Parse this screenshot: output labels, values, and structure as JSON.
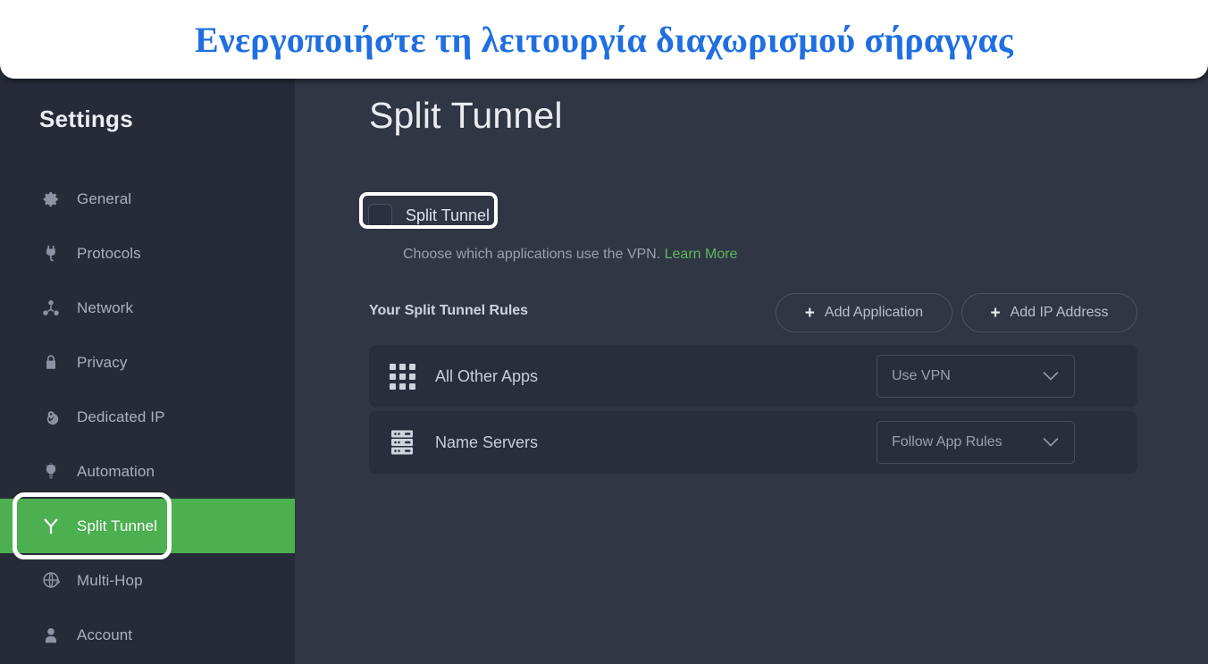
{
  "banner": {
    "text": "Ενεργοποιήστε τη λειτουργία διαχωρισμού σήραγγας",
    "color": "#1f6fe0"
  },
  "sidebar": {
    "title": "Settings",
    "active_index": 6,
    "items": [
      {
        "label": "General",
        "icon": "gear-icon"
      },
      {
        "label": "Protocols",
        "icon": "plug-icon"
      },
      {
        "label": "Network",
        "icon": "network-nodes-icon"
      },
      {
        "label": "Privacy",
        "icon": "lock-icon"
      },
      {
        "label": "Dedicated IP",
        "icon": "globe-pin-icon"
      },
      {
        "label": "Automation",
        "icon": "lightbulb-icon"
      },
      {
        "label": "Split Tunnel",
        "icon": "split-tunnel-icon"
      },
      {
        "label": "Multi-Hop",
        "icon": "globe-arrow-icon"
      },
      {
        "label": "Account",
        "icon": "person-icon"
      }
    ]
  },
  "main": {
    "page_title": "Split Tunnel",
    "toggle": {
      "label": "Split Tunnel",
      "checked": false
    },
    "description": "Choose which applications use the VPN.",
    "learn_more": "Learn More",
    "learn_more_color": "#5cb85c",
    "rules": {
      "heading": "Your Split Tunnel Rules",
      "add_application": "Add Application",
      "add_ip_address": "Add IP Address",
      "plus_glyph": "+",
      "rows": [
        {
          "name": "All Other Apps",
          "icon": "apps-grid-icon",
          "value": "Use VPN"
        },
        {
          "name": "Name Servers",
          "icon": "server-stack-icon",
          "value": "Follow App Rules"
        }
      ]
    }
  },
  "theme": {
    "accent_green": "#4caf50",
    "sidebar_bg": "#272b38",
    "content_bg": "#313645",
    "row_bg": "#2a2e3c",
    "highlight_outline": "#ffffff"
  }
}
